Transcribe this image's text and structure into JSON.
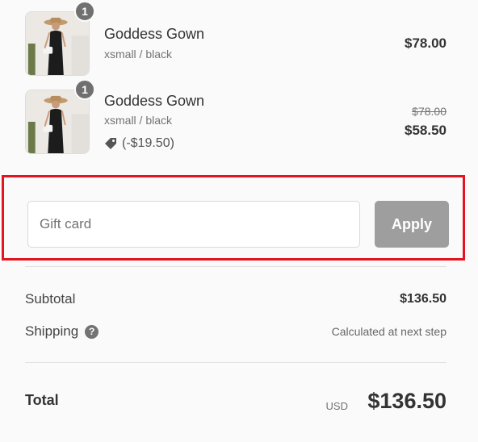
{
  "items": [
    {
      "quantity": "1",
      "name": "Goddess Gown",
      "variant": "xsmall / black",
      "price": "$78.00"
    },
    {
      "quantity": "1",
      "name": "Goddess Gown",
      "variant": "xsmall / black",
      "discount": "(-$19.50)",
      "original_price": "$78.00",
      "price": "$58.50"
    }
  ],
  "gift_card": {
    "placeholder": "Gift card",
    "value": "",
    "apply_label": "Apply"
  },
  "summary": {
    "subtotal_label": "Subtotal",
    "subtotal_value": "$136.50",
    "shipping_label": "Shipping",
    "shipping_help": "?",
    "shipping_value": "Calculated at next step",
    "total_label": "Total",
    "currency": "USD",
    "total_value": "$136.50"
  },
  "colors": {
    "highlight_border": "#e3141f",
    "apply_button": "#9e9e9e",
    "badge": "#707070"
  },
  "icons": [
    "product-thumbnail",
    "quantity-badge",
    "discount-tag-icon",
    "help-circle-icon"
  ]
}
